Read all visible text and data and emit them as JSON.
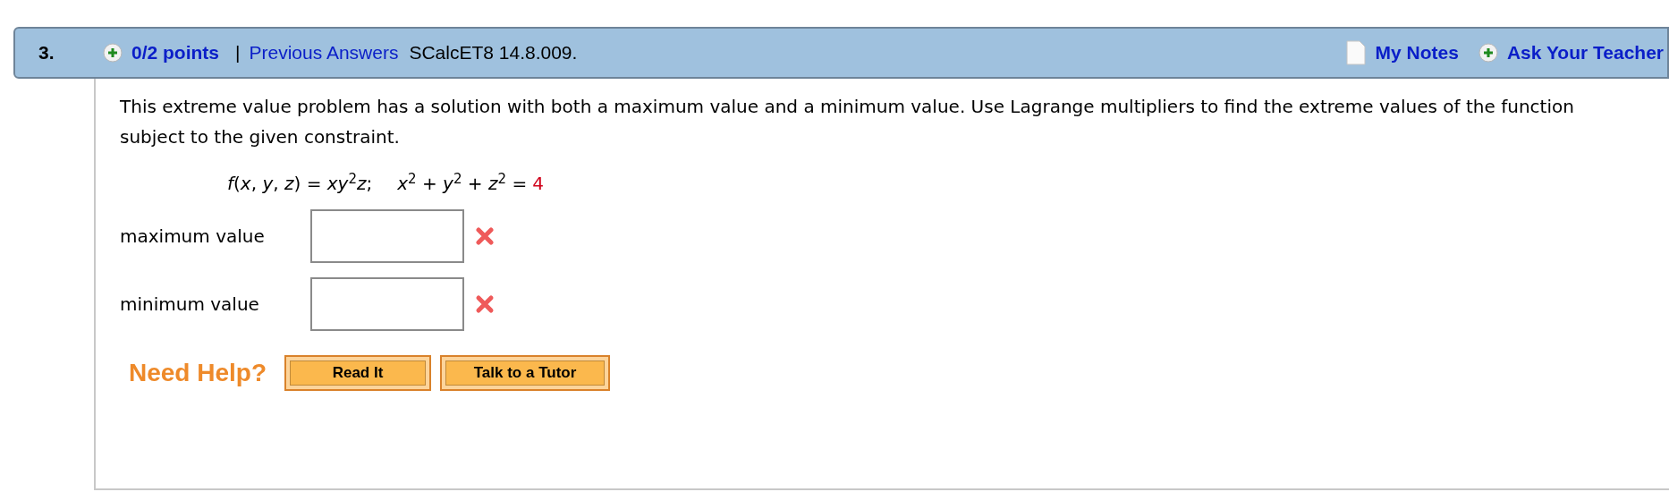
{
  "header": {
    "number": "3.",
    "points": "0/2 points",
    "separator": "|",
    "previous_answers": "Previous Answers",
    "source": "SCalcET8 14.8.009.",
    "my_notes": "My Notes",
    "ask_teacher": "Ask Your Teacher"
  },
  "question": {
    "text": "This extreme value problem has a solution with both a maximum value and a minimum value. Use Lagrange multipliers to find the extreme values of the function subject to the given constraint.",
    "function": "*f*(*x*, *y*, *z*) = *xy*$^{2}$*z*;",
    "constraint": "*x*$^{2}$ + *y*$^{2}$ + *z*$^{2}$ =",
    "constraint_value": "4"
  },
  "answers": [
    {
      "label": "maximum value",
      "correct": false
    },
    {
      "label": "minimum value",
      "correct": false
    }
  ],
  "help": {
    "label": "Need Help?",
    "buttons": [
      "Read It",
      "Talk to a Tutor"
    ]
  }
}
